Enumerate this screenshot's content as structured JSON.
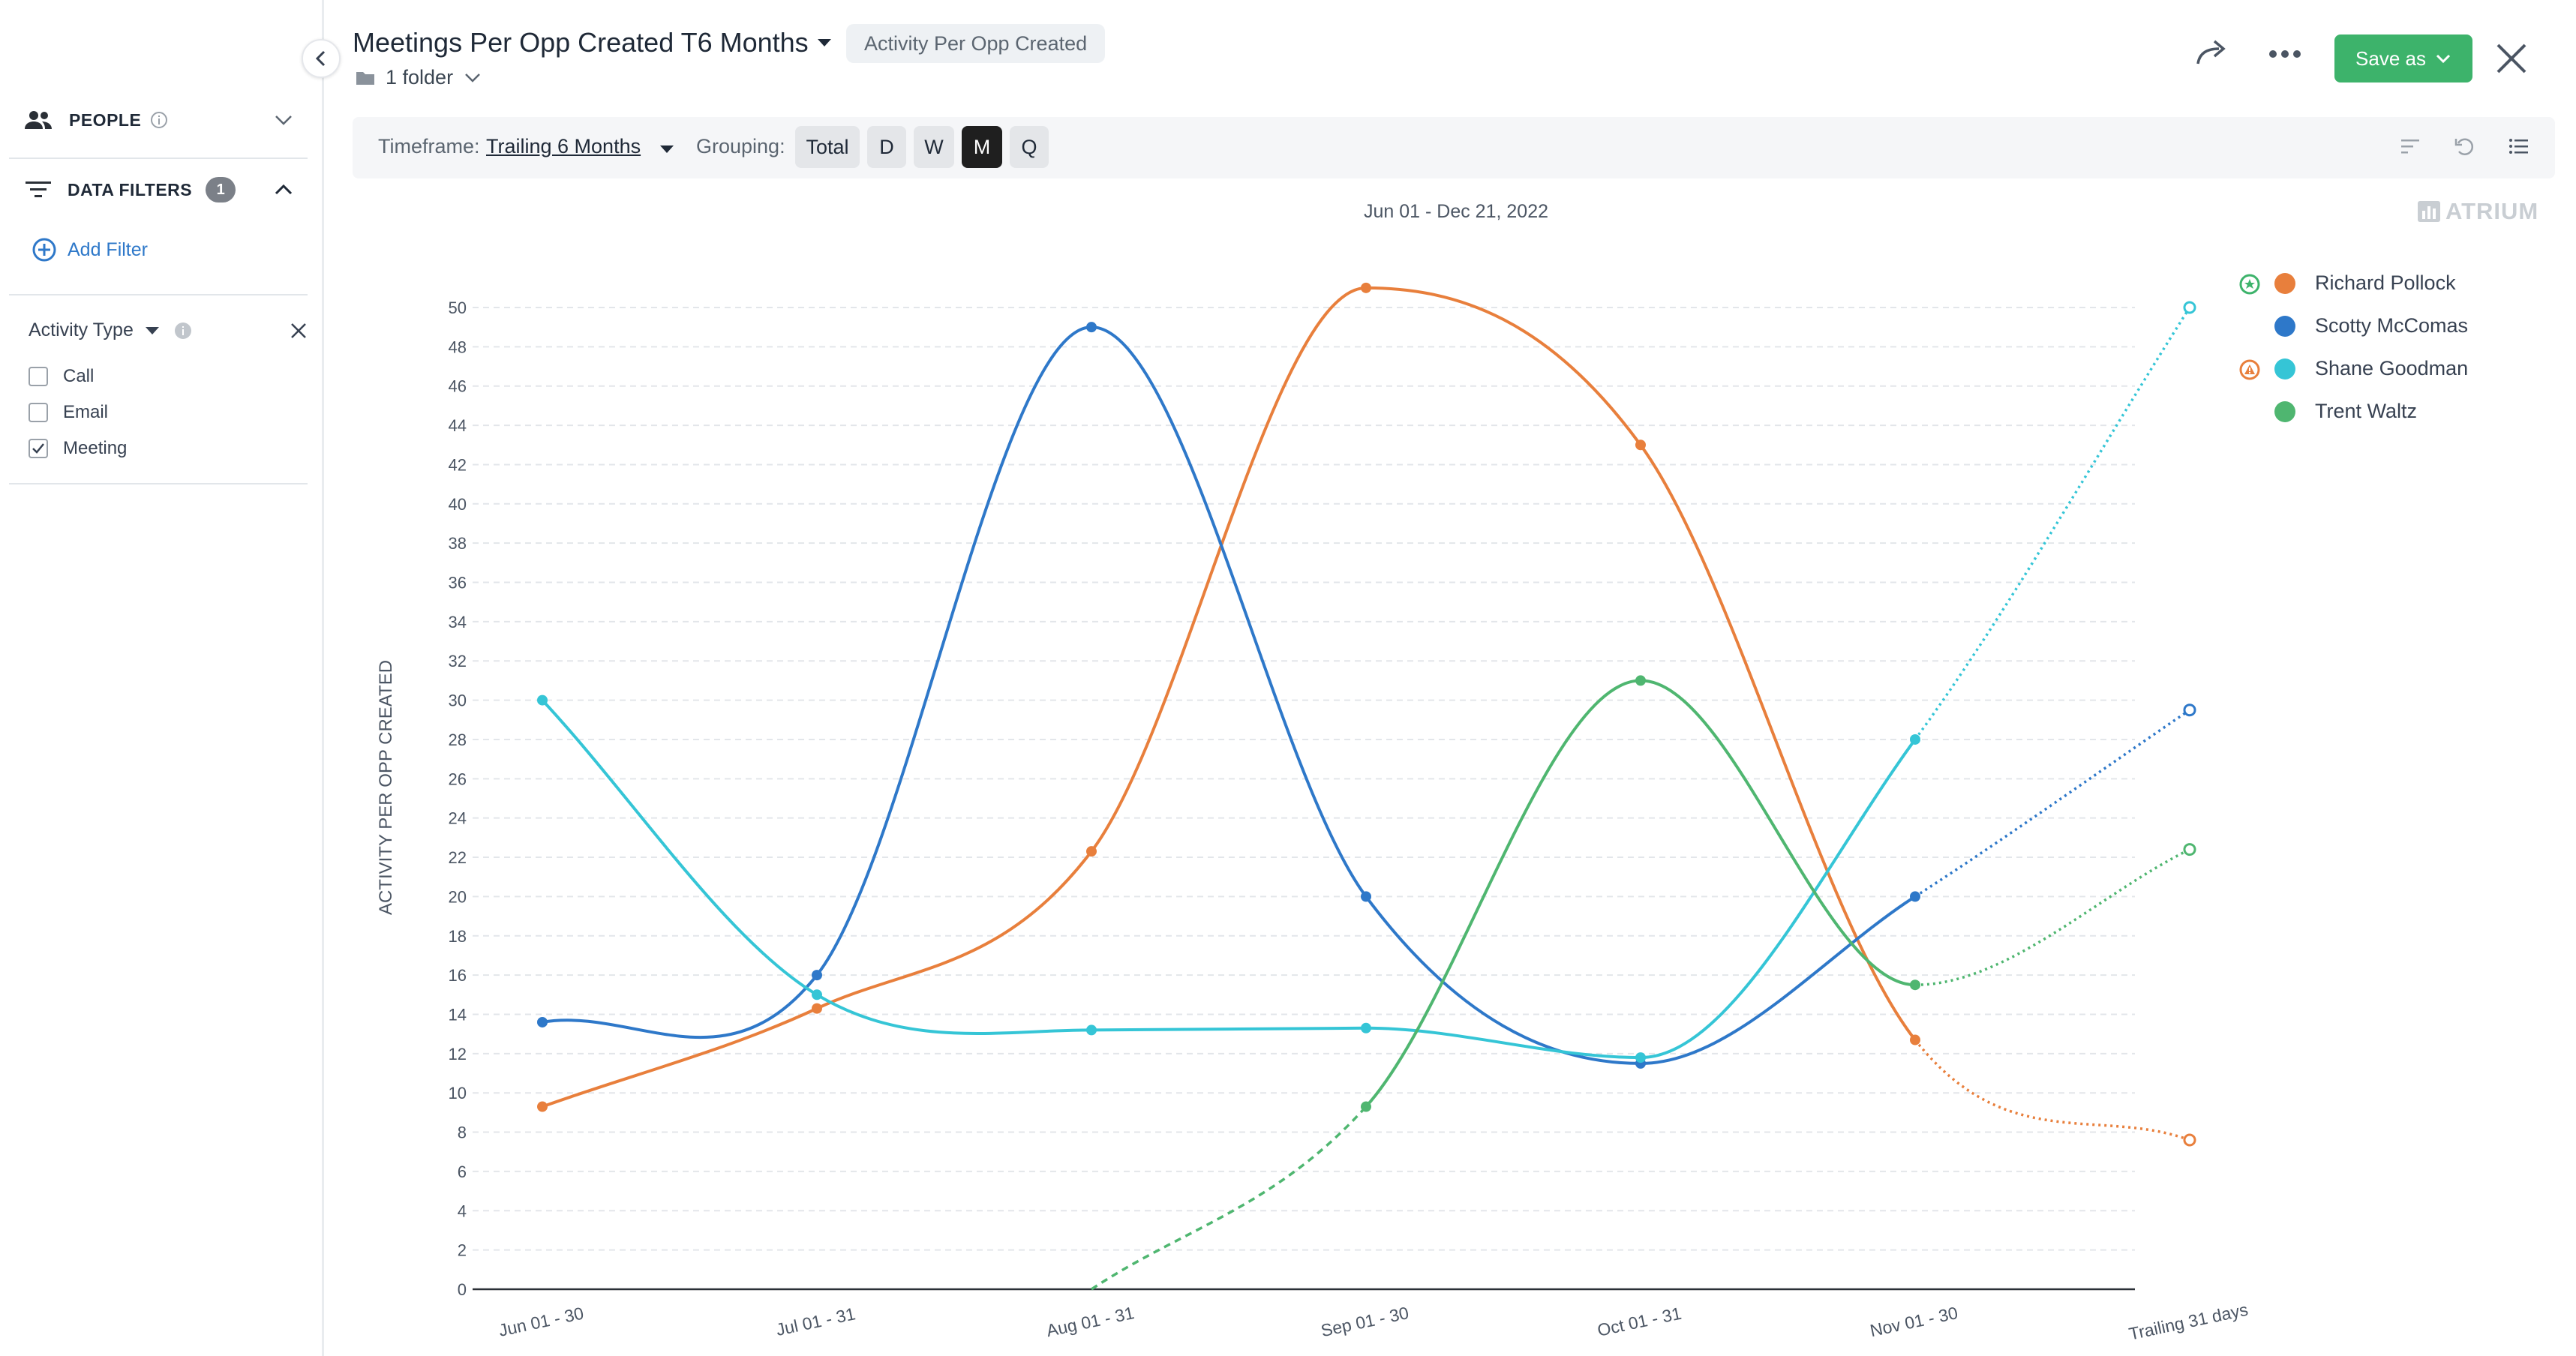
{
  "sidebar": {
    "people_label": "PEOPLE",
    "data_filters_label": "DATA FILTERS",
    "data_filters_count": "1",
    "add_filter_label": "Add Filter",
    "filter": {
      "name": "Activity Type",
      "options": [
        {
          "label": "Call",
          "checked": false
        },
        {
          "label": "Email",
          "checked": false
        },
        {
          "label": "Meeting",
          "checked": true
        }
      ]
    }
  },
  "header": {
    "title": "Meetings Per Opp Created T6 Months",
    "type_pill": "Activity Per Opp Created",
    "folder_label": "1 folder",
    "save_label": "Save as"
  },
  "toolbar": {
    "timeframe_label": "Timeframe:",
    "timeframe_value": "Trailing 6 Months",
    "grouping_label": "Grouping:",
    "grouping_options": [
      "Total",
      "D",
      "W",
      "M",
      "Q"
    ],
    "grouping_active": "M"
  },
  "brand": "ATRIUM",
  "chart_data": {
    "type": "line",
    "subtitle": "Jun 01 - Dec 21, 2022",
    "ylabel": "ACTIVITY PER OPP CREATED",
    "xlabel": "",
    "ylim": [
      0,
      50
    ],
    "yticks": [
      0,
      2,
      4,
      6,
      8,
      10,
      12,
      14,
      16,
      18,
      20,
      22,
      24,
      26,
      28,
      30,
      32,
      34,
      36,
      38,
      40,
      42,
      44,
      46,
      48,
      50
    ],
    "categories": [
      "Jun 01 - 30",
      "Jul 01 - 31",
      "Aug 01 - 31",
      "Sep 01 - 30",
      "Oct 01 - 31",
      "Nov 01 - 30",
      "Trailing 31 days"
    ],
    "grid": true,
    "legend": "right",
    "series": [
      {
        "name": "Richard Pollock",
        "color": "#e87f3c",
        "values": [
          9.3,
          14.3,
          22.3,
          51.0,
          43.0,
          12.7,
          7.6
        ],
        "projected_last": true,
        "badge": "star"
      },
      {
        "name": "Scotty McComas",
        "color": "#2e78c9",
        "values": [
          13.6,
          16.0,
          49.0,
          20.0,
          11.5,
          20.0,
          29.5
        ],
        "projected_last": true
      },
      {
        "name": "Shane Goodman",
        "color": "#35c5d6",
        "values": [
          30.0,
          15.0,
          13.2,
          13.3,
          11.8,
          28.0,
          50.0
        ],
        "projected_last": true,
        "badge": "warning"
      },
      {
        "name": "Trent Waltz",
        "color": "#4fb670",
        "values": [
          null,
          null,
          0,
          9.3,
          31.0,
          15.5,
          22.4
        ],
        "projected_last": true,
        "dashed_first": true
      }
    ]
  }
}
